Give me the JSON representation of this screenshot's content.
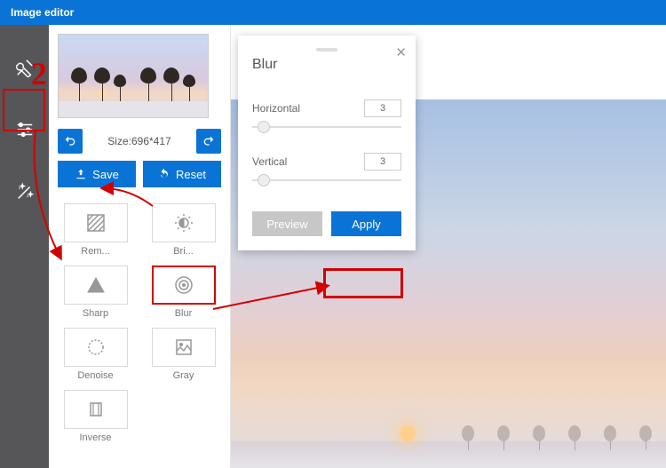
{
  "title": "Image editor",
  "size_label": "Size:",
  "size_value": "696*417",
  "buttons": {
    "save": "Save",
    "reset": "Reset"
  },
  "tools": {
    "rembg": "Rem...",
    "bright": "Bri...",
    "sharp": "Sharp",
    "blur": "Blur",
    "denoise": "Denoise",
    "gray": "Gray",
    "inverse": "Inverse"
  },
  "dialog": {
    "title": "Blur",
    "horizontal_label": "Horizontal",
    "horizontal_value": "3",
    "vertical_label": "Vertical",
    "vertical_value": "3",
    "preview": "Preview",
    "apply": "Apply"
  },
  "annotation_number": "2"
}
